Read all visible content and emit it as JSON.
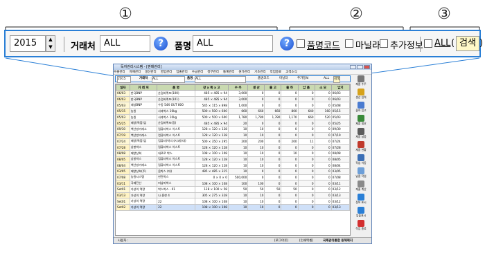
{
  "callouts": [
    "①",
    "②",
    "③"
  ],
  "filter": {
    "year": "2015",
    "customer_label": "거래처",
    "customer_value": "ALL",
    "product_label": "품명",
    "product_value": "ALL",
    "help_glyph": "?",
    "product_code_label": "품명코드",
    "deadline_label": "마닐라",
    "extra_info_label": "추가정보",
    "all_label": "ALL",
    "search_label": "검색",
    "paren_open": "(",
    "paren_close": ")"
  },
  "app": {
    "title": "독자관리시스템 - [판매관리]",
    "menu": [
      "수출관리",
      "자재관리",
      "생산관리",
      "영업관리",
      "입출관리",
      "수금관리",
      "정부관리",
      "통계관리",
      "원가관리",
      "기초관리",
      "작업종료",
      "고객소식"
    ],
    "filter": {
      "year": "2015",
      "customer_label": "거래처",
      "customer_value": "ALL",
      "product_label": "품명",
      "product_value": "ALL",
      "product_code_label": "품명코드",
      "deadline_label": "마닐라",
      "extra_info_label": "추가정보",
      "all_label": "ALL",
      "search_label": "검색"
    },
    "columns": [
      "일자",
      "거 래 처",
      "품 명",
      "장 x 폭 x 고",
      "수 주",
      "생 산",
      "출 고",
      "출 하",
      "납 품",
      "소 모",
      "납기"
    ],
    "rows": [
      [
        "06/03",
        "한국BNP",
        "순검바퀴포(100)",
        "485 × 485 × 94",
        "3,000",
        "0",
        "0",
        "0",
        "0",
        "0",
        "06/03"
      ],
      [
        "06/03",
        "한국BNP",
        "순검바퀴포(101)",
        "485 × 485 × 94",
        "3,000",
        "0",
        "0",
        "0",
        "0",
        "0",
        "06/03"
      ],
      [
        "05/03",
        "대성BNP",
        "수동 54X OUT 800",
        "545 × 115 × 898",
        "1,000",
        "0",
        "0",
        "0",
        "0",
        "0",
        "05/08"
      ],
      [
        "05/15",
        "농원",
        "사과박스 10kg",
        "500 × 500 × 600",
        "660",
        "660",
        "660",
        "800",
        "640",
        "160",
        "05/15"
      ],
      [
        "05/03",
        "농원",
        "사과박스 10kg",
        "500 × 500 × 600",
        "1,780",
        "1,780",
        "1,780",
        "1,170",
        "660",
        "520",
        "05/03"
      ],
      [
        "05/25",
        "태양(특합)업",
        "순검바퀴포(장)",
        "485 × 485 × 94",
        "20",
        "0",
        "0",
        "0",
        "0",
        "0",
        "05/25"
      ],
      [
        "09/30",
        "백산방거래소",
        "컴퓨터박스 이스트",
        "128 × 120 × 128",
        "10",
        "10",
        "0",
        "0",
        "0",
        "0",
        "09/30"
      ],
      [
        "07/19",
        "백산방거래소",
        "컴퓨터박스 이스트",
        "128 × 120 × 128",
        "10",
        "10",
        "0",
        "0",
        "0",
        "0",
        "07/19"
      ],
      [
        "07/24",
        "태양(특합)업",
        "컴퓨터(박스)(사과)(대)",
        "500 × 350 × 295",
        "200",
        "200",
        "0",
        "200",
        "11",
        "0",
        "07/24"
      ],
      [
        "07/28",
        "상봉박스",
        "컴퓨터박스 이스트",
        "128 × 120 × 128",
        "10",
        "10",
        "0",
        "0",
        "0",
        "0",
        "07/28"
      ],
      [
        "08/08",
        "태양상회",
        "내료로 박스",
        "108 × 100 × 108",
        "10",
        "10",
        "0",
        "10",
        "0",
        "0",
        "08/08"
      ],
      [
        "08/05",
        "상봉박스",
        "컴퓨터박스 이스트",
        "128 × 120 × 128",
        "10",
        "10",
        "0",
        "0",
        "0",
        "0",
        "08/05"
      ],
      [
        "08/04",
        "백산방거래소",
        "컴퓨터박스 이스트",
        "128 × 120 × 128",
        "10",
        "10",
        "0",
        "0",
        "0",
        "0",
        "08/04"
      ],
      [
        "03/05",
        "태양상회(주)",
        "움박스 (대)",
        "485 × 485 × 315",
        "10",
        "0",
        "0",
        "0",
        "0",
        "0",
        "03/05"
      ],
      [
        "07/08",
        "농원시스템",
        "판탄박스",
        "0 × 0 × 0",
        "500,000",
        "0",
        "0",
        "0",
        "0",
        "0",
        "07/08"
      ],
      [
        "03/11",
        "국제전산",
        "미남미박스",
        "108 × 100 × 108",
        "100",
        "100",
        "0",
        "0",
        "0",
        "0",
        "03/11"
      ],
      [
        "Set01",
        "가성의 역량",
        "박스박스 - 01",
        "128 × 100 × 58",
        "50",
        "50",
        "50",
        "50",
        "0",
        "0",
        "03/12"
      ],
      [
        "03/13",
        "가성의 역량",
        "나.흥한 4",
        "305 × 275 × 328",
        "10",
        "10",
        "0",
        "0",
        "0",
        "0",
        "03/13"
      ],
      [
        "Set01",
        "가성의 역량",
        "22",
        "108 × 100 × 108",
        "10",
        "10",
        "0",
        "0",
        "0",
        "0",
        "03/12"
      ],
      [
        "Set02",
        "가성의 역량",
        "22",
        "108 × 100 × 108",
        "10",
        "10",
        "0",
        "0",
        "0",
        "0",
        "03/13"
      ]
    ],
    "sidebar": [
      "제품 수주",
      "생산 입력",
      "출하 입고",
      "제품 생산",
      "재품 납품",
      "재품 현황",
      "작업 이동",
      "납품 작업",
      "재출 계산",
      "정보 표시",
      "입출표시",
      "작업 종료"
    ],
    "status": {
      "user": "사용자 :",
      "exit": "[로그아웃]",
      "print": "[인쇄엑셀]",
      "company": "국제관리통합 동해제지"
    }
  },
  "colors": {
    "accent": "#2a7fd6",
    "header_bg": "#c9d9b0",
    "search_bg": "#fff8c8"
  }
}
